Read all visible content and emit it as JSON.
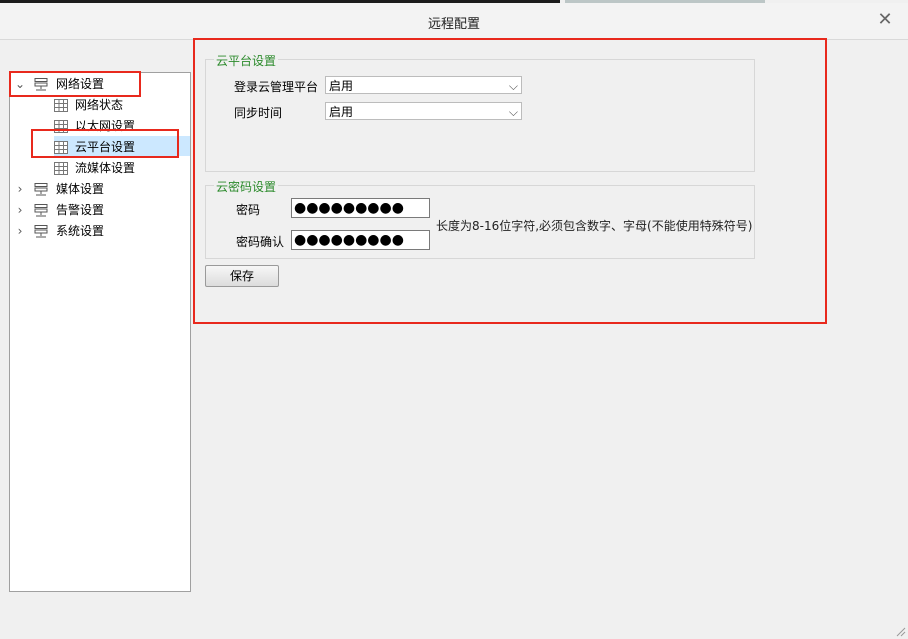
{
  "window": {
    "title": "远程配置"
  },
  "tree": {
    "items": [
      {
        "label": "网络设置",
        "level": 0,
        "expanded": true
      },
      {
        "label": "网络状态",
        "level": 1
      },
      {
        "label": "以太网设置",
        "level": 1
      },
      {
        "label": "云平台设置",
        "level": 1,
        "selected": true
      },
      {
        "label": "流媒体设置",
        "level": 1
      },
      {
        "label": "媒体设置",
        "level": 0,
        "expanded": false
      },
      {
        "label": "告警设置",
        "level": 0,
        "expanded": false
      },
      {
        "label": "系统设置",
        "level": 0,
        "expanded": false
      }
    ]
  },
  "cloud_platform": {
    "group_title": "云平台设置",
    "login_label": "登录云管理平台",
    "login_value": "启用",
    "sync_label": "同步时间",
    "sync_value": "启用"
  },
  "cloud_password": {
    "group_title": "云密码设置",
    "password_label": "密码",
    "password_value": "●●●●●●●●●",
    "confirm_label": "密码确认",
    "confirm_value": "●●●●●●●●●",
    "hint": "长度为8-16位字符,必须包含数字、字母(不能使用特殊符号)"
  },
  "actions": {
    "save_label": "保存"
  },
  "colors": {
    "group_title": "#2b8a2b",
    "highlight": "#e8291d",
    "selection": "#cce8ff"
  }
}
